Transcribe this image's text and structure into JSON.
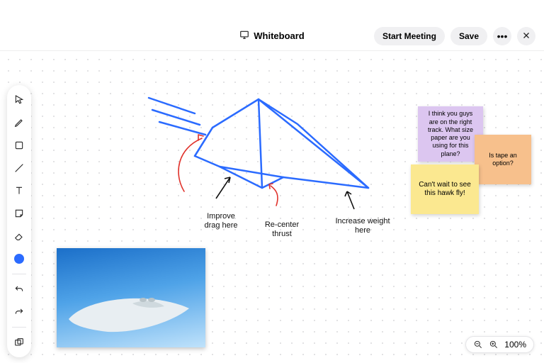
{
  "header": {
    "title": "Whiteboard",
    "start_meeting": "Start Meeting",
    "save": "Save"
  },
  "stickies": {
    "purple": "I think you guys are on the right track. What size paper are you using for this plane?",
    "orange": "Is tape an option?",
    "yellow": "Can't wait to see this hawk fly!"
  },
  "annotations": {
    "improve_drag": "Improve drag here",
    "recenter_thrust": "Re-center thrust",
    "increase_weight": "Increase weight here"
  },
  "zoom": {
    "level": "100%"
  },
  "toolbar": {
    "selected_color": "#2b6bff"
  }
}
